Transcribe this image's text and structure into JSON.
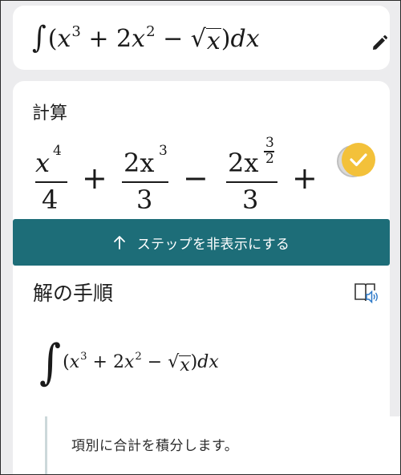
{
  "problem": {
    "expression": {
      "integral": "∫",
      "open_paren": "(",
      "x": "x",
      "exp3": "3",
      "plus": "+",
      "coef2": "2",
      "exp2": "2",
      "minus": "−",
      "radical": "√",
      "sqrt_arg": "x",
      "close": ")",
      "dx": "dx"
    },
    "edit_icon": "pencil-icon"
  },
  "result": {
    "label": "計算",
    "terms": {
      "t1_num": "x",
      "t1_num_exp": "4",
      "t1_den": "4",
      "op1": "+",
      "t2_num": "2x",
      "t2_num_exp": "3",
      "t2_den": "3",
      "op2": "−",
      "t3_num": "2x",
      "t3_exp_num": "3",
      "t3_exp_den": "2",
      "t3_den": "3",
      "op3": "+"
    },
    "check_icon": "checkmark-icon",
    "accent_color": "#f3c13a"
  },
  "steps_button": {
    "label": "ステップを非表示にする",
    "icon": "arrow-up-icon",
    "color": "#1d6d78"
  },
  "steps": {
    "title": "解の手順",
    "reader_icon": "immersive-reader-icon",
    "expression": {
      "integral": "∫",
      "open_paren": "(",
      "x": "x",
      "exp3": "3",
      "plus": "+",
      "coef2": "2",
      "exp2": "2",
      "minus": "−",
      "radical": "√",
      "sqrt_arg": "x",
      "close": ")",
      "dx": "dx"
    },
    "step1_text": "項別に合計を積分します。"
  }
}
